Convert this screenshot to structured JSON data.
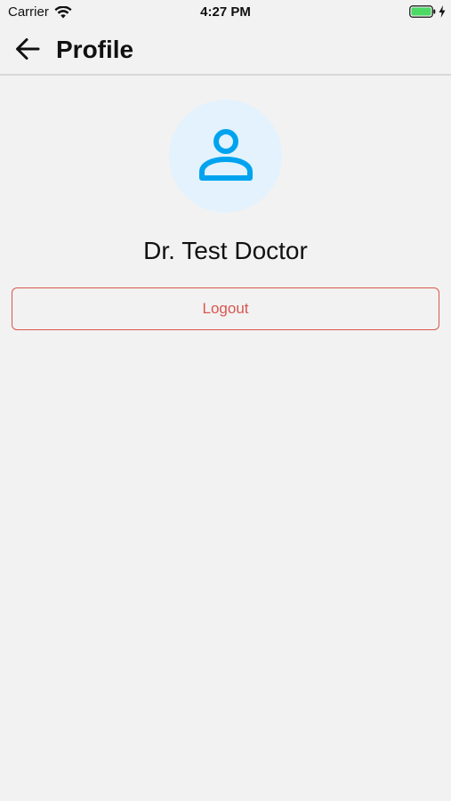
{
  "status_bar": {
    "carrier": "Carrier",
    "time": "4:27 PM",
    "battery_color": "#4cd964"
  },
  "nav": {
    "title": "Profile",
    "back_icon": "arrow-left-icon"
  },
  "profile": {
    "avatar_icon": "person-icon",
    "avatar_bg": "#e3f2fc",
    "avatar_icon_color": "#00a3ef",
    "name": "Dr. Test Doctor"
  },
  "actions": {
    "logout_label": "Logout",
    "logout_color": "#d9574f"
  }
}
